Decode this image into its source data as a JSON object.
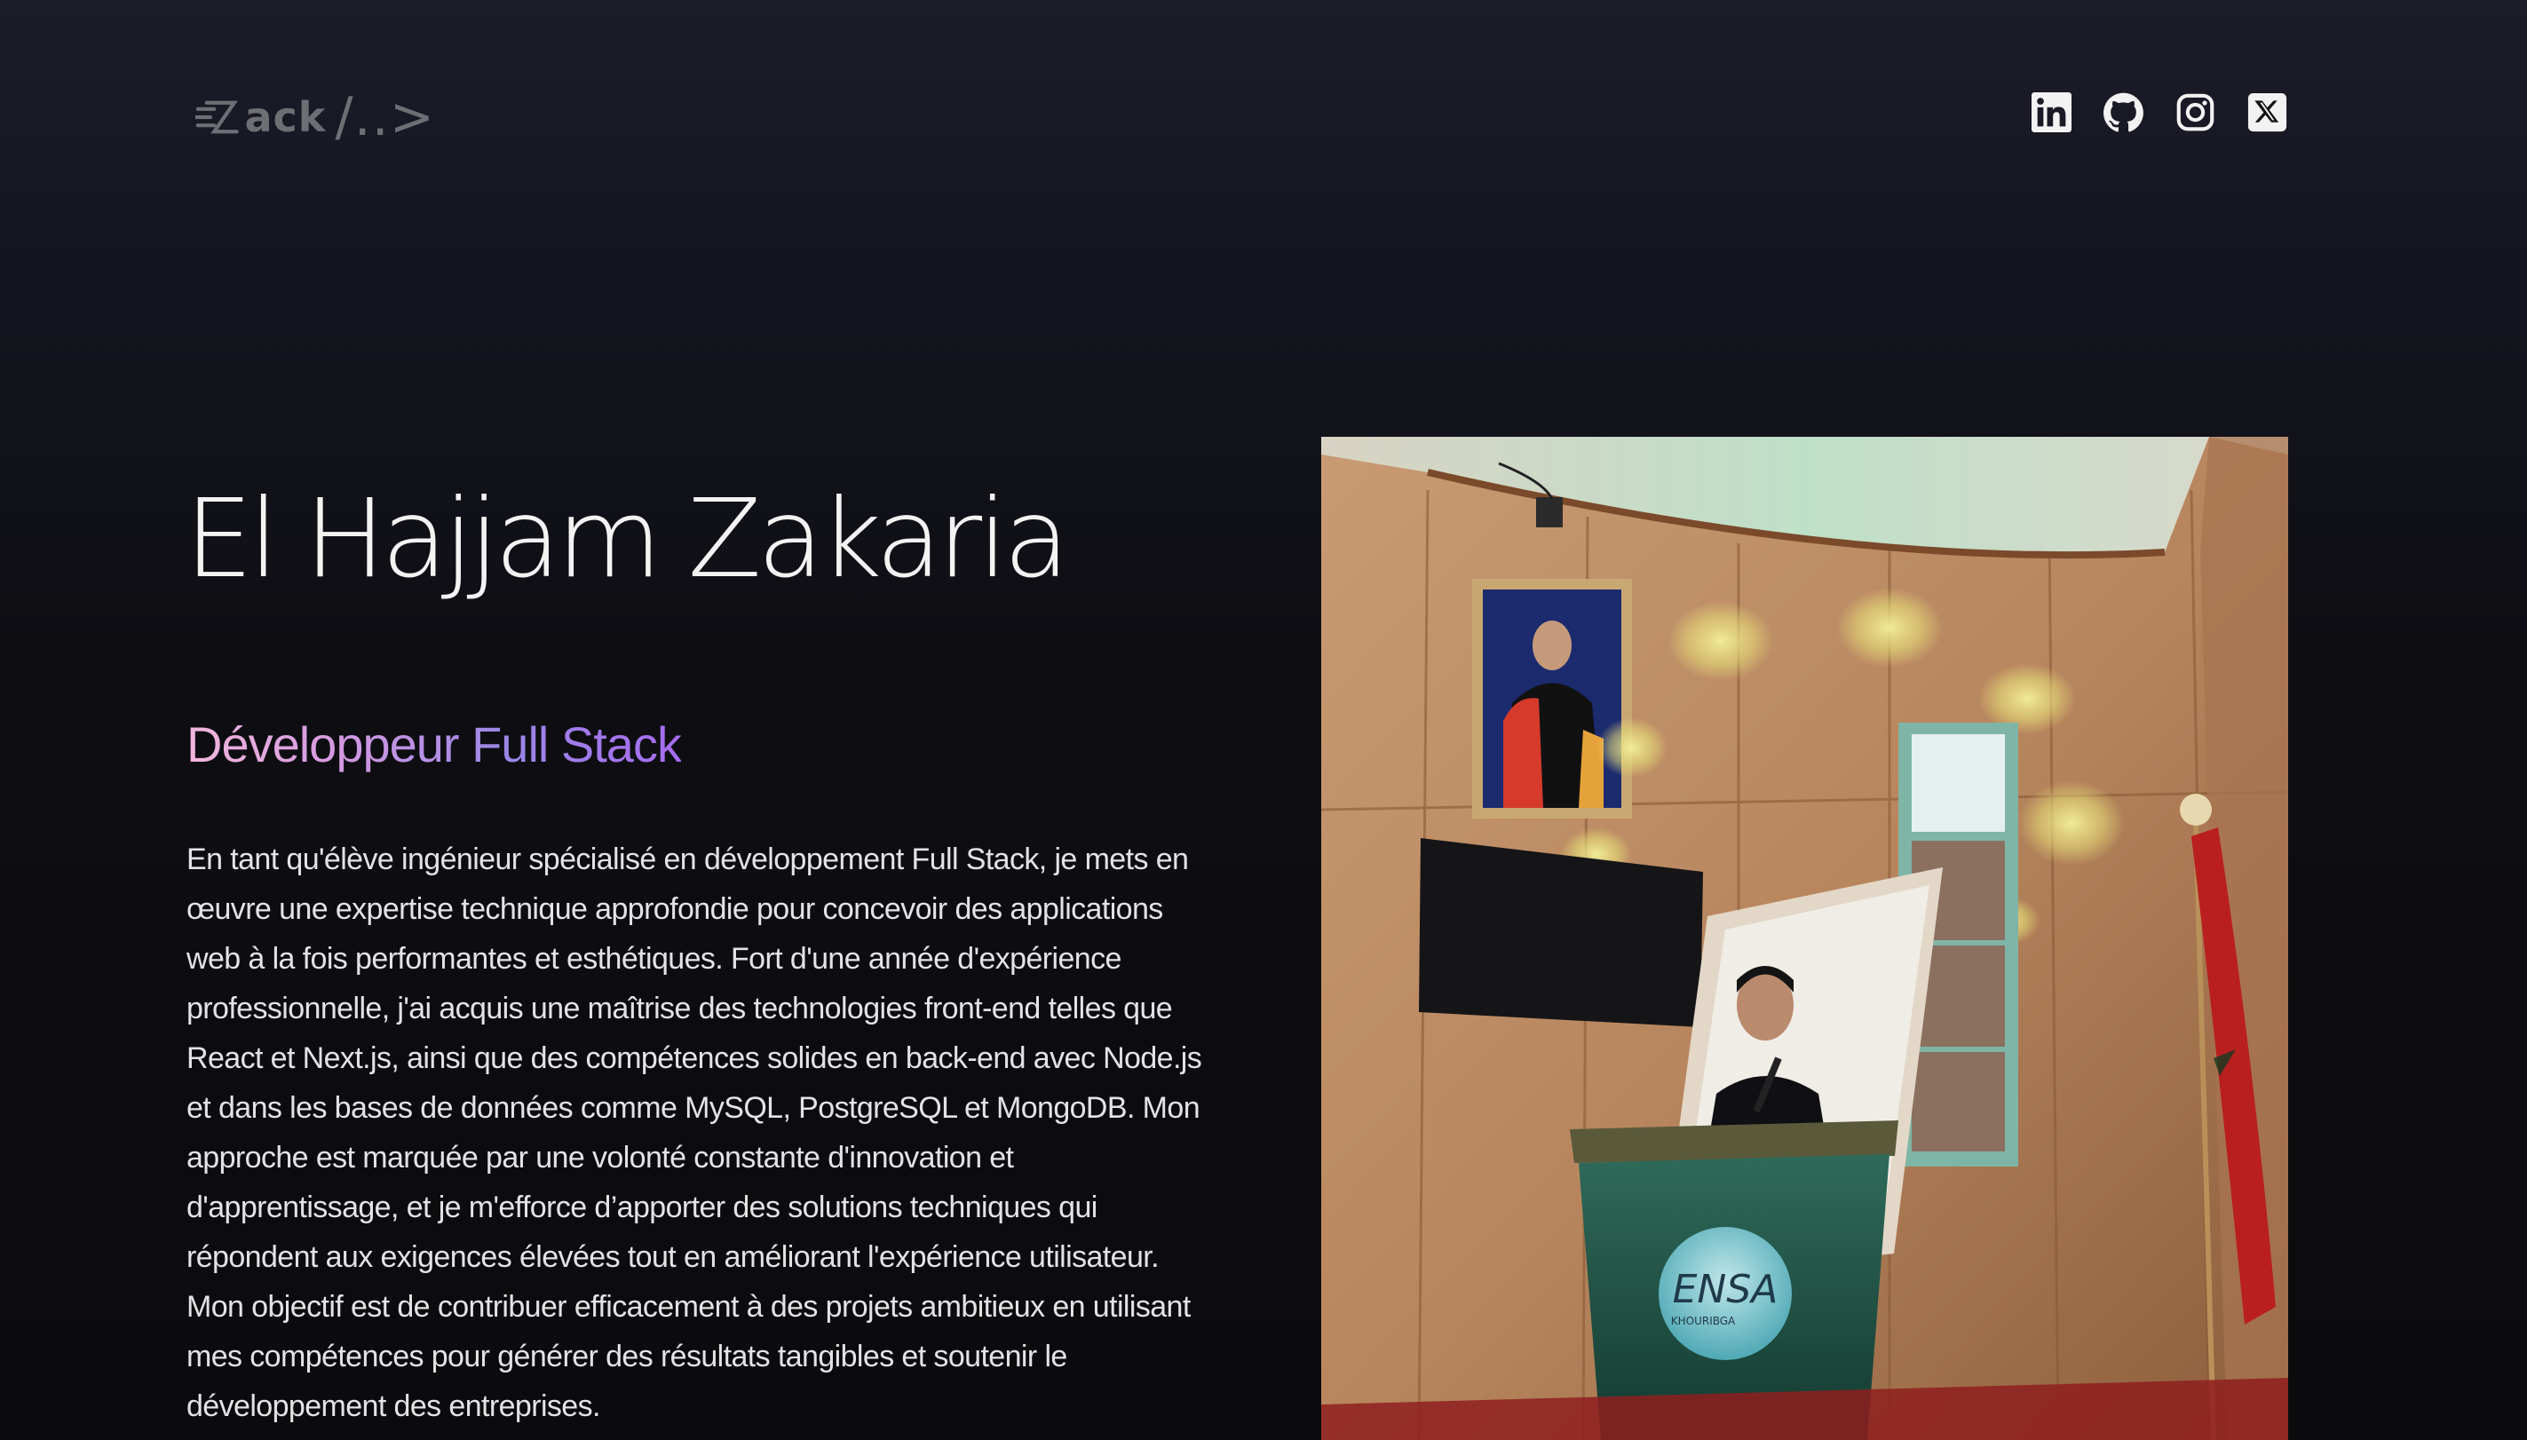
{
  "header": {
    "logo": {
      "text": "ack",
      "mark_icon": "speed-lines-z-icon",
      "tail": "/..>"
    },
    "social": [
      {
        "name": "linkedin",
        "icon": "linkedin-icon"
      },
      {
        "name": "github",
        "icon": "github-icon"
      },
      {
        "name": "instagram",
        "icon": "instagram-icon"
      },
      {
        "name": "x",
        "icon": "x-icon"
      }
    ]
  },
  "hero": {
    "name": "El Hajjam Zakaria",
    "role": "Développeur Full Stack",
    "description": "En tant qu'élève ingénieur spécialisé en développement Full Stack, je mets en œuvre une expertise technique approfondie pour concevoir des applications web à la fois performantes et esthétiques. Fort d'une année d'expérience professionnelle, j'ai acquis une maîtrise des technologies front-end telles que React et Next.js, ainsi que des compétences solides en back-end avec Node.js et dans les bases de données comme MySQL, PostgreSQL et MongoDB. Mon approche est marquée par une volonté constante d'innovation et d'apprentissage, et je m'efforce d’apporter des solutions techniques qui répondent aux exigences élevées tout en améliorant l'expérience utilisateur. Mon objectif est de contribuer efficacement à des projets ambitieux en utilisant mes compétences pour générer des résultats tangibles et soutenir le développement des entreprises."
  },
  "photo": {
    "podium_text": "ENSA",
    "podium_subtext": "KHOURIBGA"
  },
  "colors": {
    "background_top": "#1d1d2a",
    "background_bottom": "#0b0b0d",
    "role_gradient_start": "#f2b7dc",
    "role_gradient_end": "#a76cf0",
    "logo": "#6e6e75"
  }
}
